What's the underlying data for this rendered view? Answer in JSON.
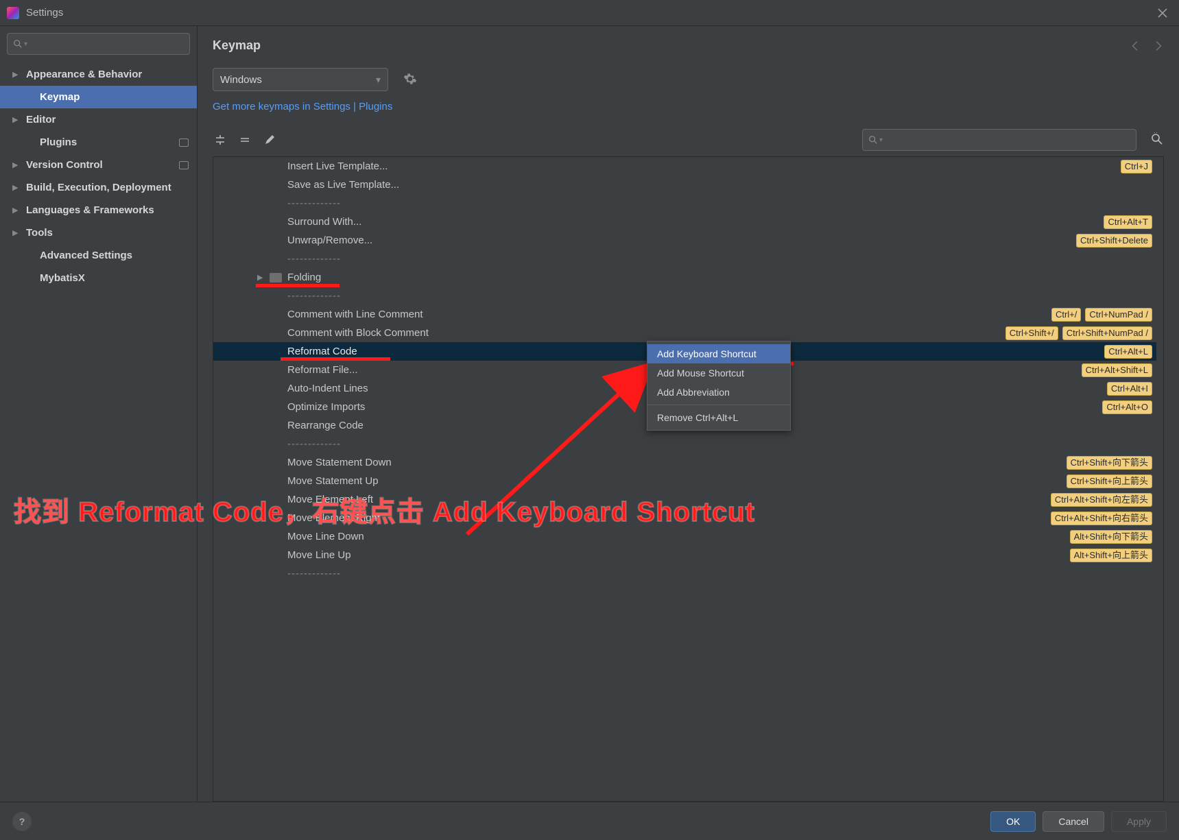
{
  "window": {
    "title": "Settings"
  },
  "sidebar": {
    "search_placeholder": "",
    "items": [
      {
        "label": "Appearance & Behavior",
        "expandable": true
      },
      {
        "label": "Keymap",
        "expandable": false,
        "selected": true
      },
      {
        "label": "Editor",
        "expandable": true
      },
      {
        "label": "Plugins",
        "expandable": false,
        "badge": true
      },
      {
        "label": "Version Control",
        "expandable": true,
        "badge": true
      },
      {
        "label": "Build, Execution, Deployment",
        "expandable": true
      },
      {
        "label": "Languages & Frameworks",
        "expandable": true
      },
      {
        "label": "Tools",
        "expandable": true
      },
      {
        "label": "Advanced Settings",
        "expandable": false
      },
      {
        "label": "MybatisX",
        "expandable": false
      }
    ]
  },
  "header": {
    "title": "Keymap",
    "scheme": "Windows",
    "link": "Get more keymaps in Settings | Plugins"
  },
  "tree": [
    {
      "label": "Insert Live Template...",
      "shortcuts": [
        "Ctrl+J"
      ]
    },
    {
      "label": "Save as Live Template..."
    },
    {
      "label": "-------------",
      "sep": true
    },
    {
      "label": "Surround With...",
      "shortcuts": [
        "Ctrl+Alt+T"
      ]
    },
    {
      "label": "Unwrap/Remove...",
      "shortcuts": [
        "Ctrl+Shift+Delete"
      ]
    },
    {
      "label": "-------------",
      "sep": true
    },
    {
      "label": "Folding",
      "folder": true
    },
    {
      "label": "-------------",
      "sep": true
    },
    {
      "label": "Comment with Line Comment",
      "shortcuts": [
        "Ctrl+/",
        "Ctrl+NumPad /"
      ]
    },
    {
      "label": "Comment with Block Comment",
      "shortcuts": [
        "Ctrl+Shift+/",
        "Ctrl+Shift+NumPad /"
      ]
    },
    {
      "label": "Reformat Code",
      "shortcuts": [
        "Ctrl+Alt+L"
      ],
      "selected": true
    },
    {
      "label": "Reformat File...",
      "shortcuts": [
        "Ctrl+Alt+Shift+L"
      ]
    },
    {
      "label": "Auto-Indent Lines",
      "shortcuts": [
        "Ctrl+Alt+I"
      ]
    },
    {
      "label": "Optimize Imports",
      "shortcuts": [
        "Ctrl+Alt+O"
      ]
    },
    {
      "label": "Rearrange Code"
    },
    {
      "label": "-------------",
      "sep": true
    },
    {
      "label": "Move Statement Down",
      "shortcuts": [
        "Ctrl+Shift+向下箭头"
      ]
    },
    {
      "label": "Move Statement Up",
      "shortcuts": [
        "Ctrl+Shift+向上箭头"
      ]
    },
    {
      "label": "Move Element Left",
      "shortcuts": [
        "Ctrl+Alt+Shift+向左箭头"
      ]
    },
    {
      "label": "Move Element Right",
      "shortcuts": [
        "Ctrl+Alt+Shift+向右箭头"
      ]
    },
    {
      "label": "Move Line Down",
      "shortcuts": [
        "Alt+Shift+向下箭头"
      ]
    },
    {
      "label": "Move Line Up",
      "shortcuts": [
        "Alt+Shift+向上箭头"
      ]
    },
    {
      "label": "-------------",
      "sep": true
    }
  ],
  "context_menu": {
    "items": [
      {
        "label": "Add Keyboard Shortcut",
        "selected": true
      },
      {
        "label": "Add Mouse Shortcut"
      },
      {
        "label": "Add Abbreviation"
      }
    ],
    "remove": "Remove Ctrl+Alt+L"
  },
  "footer": {
    "ok": "OK",
    "cancel": "Cancel",
    "apply": "Apply"
  },
  "annotation": "找到 Reformat Code，右键点击 Add Keyboard Shortcut"
}
